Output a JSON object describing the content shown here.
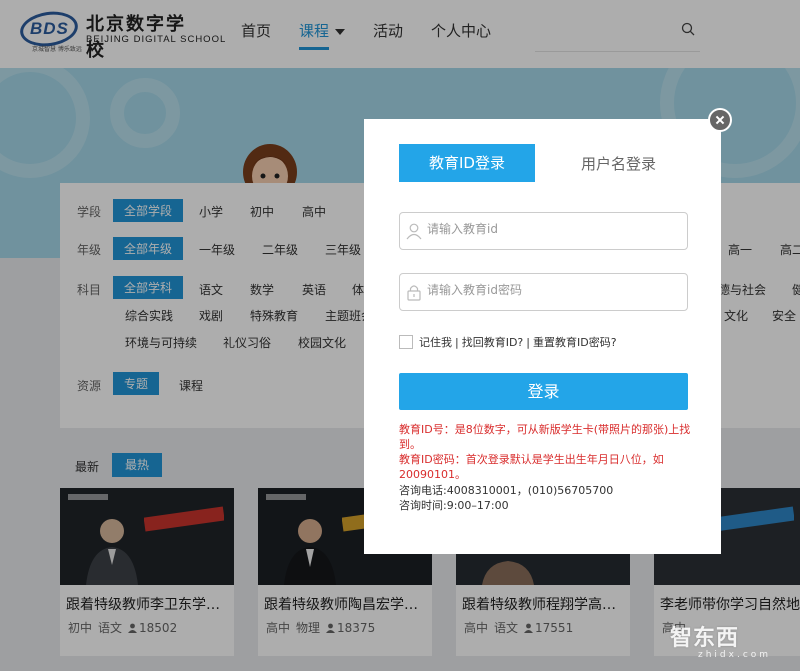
{
  "header": {
    "logo": {
      "badge_text": "BDS",
      "name_cn": "北京数字学校",
      "name_en": "BEIJING DIGITAL SCHOOL",
      "tagline": "京城智慧 博乐致远"
    },
    "nav": [
      {
        "label": "首页"
      },
      {
        "label": "课程"
      },
      {
        "label": "活动"
      },
      {
        "label": "个人中心"
      }
    ],
    "active_nav": "课程",
    "search_icon": "search-icon"
  },
  "filters": {
    "stage": {
      "label": "学段",
      "options": [
        "全部学段",
        "小学",
        "初中",
        "高中"
      ],
      "selected": "全部学段"
    },
    "grade": {
      "label": "年级",
      "options": [
        "全部年级",
        "一年级",
        "二年级",
        "三年级"
      ],
      "right_options": [
        "高一",
        "高二"
      ],
      "selected": "全部年级"
    },
    "subject": {
      "label": "科目",
      "options_row1": [
        "全部学科",
        "语文",
        "数学",
        "英语",
        "体"
      ],
      "right_row1": [
        "德与社会",
        "健"
      ],
      "options_row2": [
        "综合实践",
        "戏剧",
        "特殊教育",
        "主题班会"
      ],
      "right_row2": [
        "文化",
        "安全"
      ],
      "options_row3": [
        "环境与可持续",
        "礼仪习俗",
        "校园文化"
      ],
      "selected": "全部学科"
    },
    "resource": {
      "label": "资源",
      "options": [
        "专题",
        "课程"
      ],
      "selected": "专题"
    }
  },
  "sort_tabs": {
    "latest": "最新",
    "hot": "最热",
    "selected": "最热"
  },
  "courses": [
    {
      "title": "跟着特级教师李卫东学…",
      "stage": "初中",
      "subject": "语文",
      "views": "18502",
      "board_color": "#c9342d"
    },
    {
      "title": "跟着特级教师陶昌宏学…",
      "stage": "高中",
      "subject": "物理",
      "views": "18375",
      "board_color": "#d4a12a"
    },
    {
      "title": "跟着特级教师程翔学高…",
      "stage": "高中",
      "subject": "语文",
      "views": "17551",
      "board_color": "#2f86c8"
    },
    {
      "title": "李老师带你学习自然地…",
      "stage": "高中",
      "subject": "",
      "views": "",
      "board_color": "#2f86c8"
    }
  ],
  "login_modal": {
    "tab_eduid": "教育ID登录",
    "tab_username": "用户名登录",
    "eduid_placeholder": "请输入教育id",
    "password_placeholder": "请输入教育id密码",
    "remember": "记住我",
    "sep": "|",
    "retrieve": "找回教育ID?",
    "reset": "重置教育ID密码?",
    "login_button": "登录",
    "note_line1": "教育ID号：是8位数字，可从新版学生卡(带照片的那张)上找到。",
    "note_line2": "教育ID密码：首次登录默认是学生出生年月日八位，如20090101。",
    "contact_phone": "咨询电话:4008310001，(010)56705700",
    "contact_hours": "咨询时间:9:00–17:00"
  },
  "watermark": {
    "text": "智东西",
    "sub": "zhidx.com"
  },
  "colors": {
    "accent": "#23a5e8",
    "hero": "#a5d8e9",
    "note_red": "#d92d2d"
  }
}
